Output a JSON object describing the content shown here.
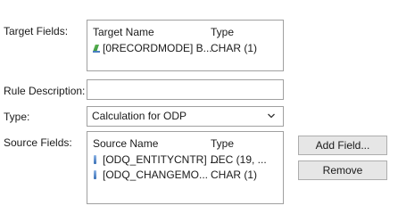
{
  "target_fields": {
    "label": "Target Fields:",
    "headers": {
      "name": "Target Name",
      "type": "Type"
    },
    "rows": [
      {
        "icon": "green-infoobject-icon",
        "name": "[0RECORDMODE] B...",
        "type": "CHAR (1)"
      }
    ]
  },
  "rule_description": {
    "label": "Rule Description:",
    "value": ""
  },
  "type_field": {
    "label": "Type:",
    "value": "Calculation for ODP"
  },
  "source_fields": {
    "label": "Source Fields:",
    "headers": {
      "name": "Source Name",
      "type": "Type"
    },
    "rows": [
      {
        "icon": "field-icon",
        "name": "[ODQ_ENTITYCNTR] ...",
        "type": "DEC (19, ..."
      },
      {
        "icon": "field-icon",
        "name": "[ODQ_CHANGEMO...",
        "type": "CHAR (1)"
      }
    ],
    "buttons": {
      "add": "Add Field...",
      "remove": "Remove"
    }
  }
}
